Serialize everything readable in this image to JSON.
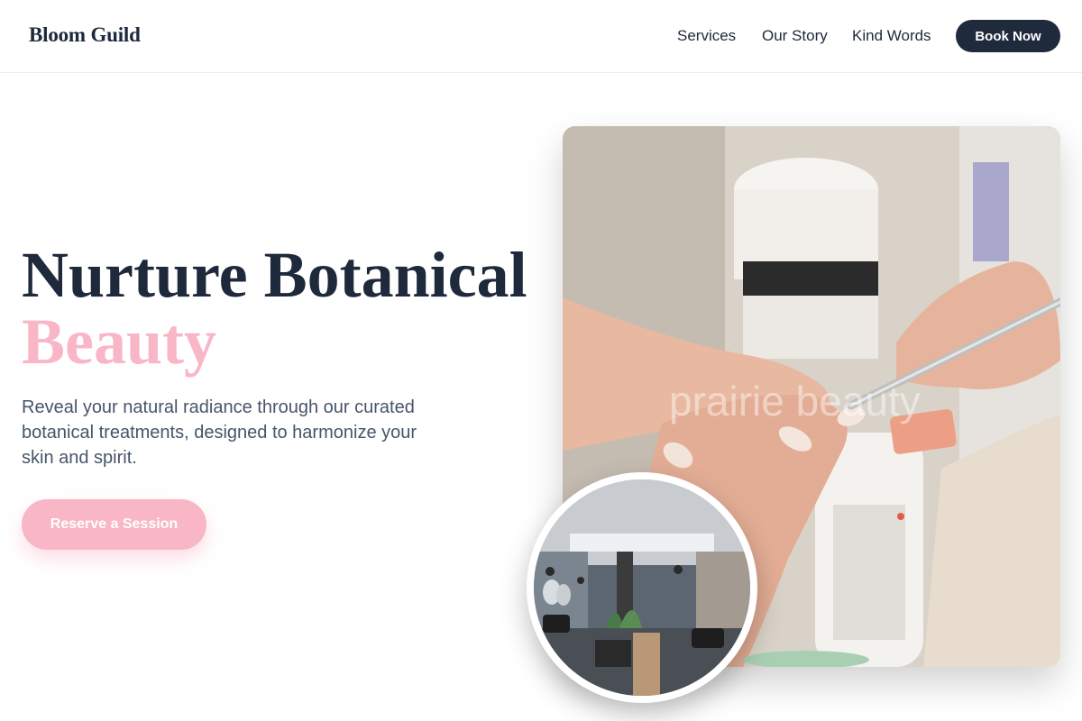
{
  "header": {
    "brand": "Bloom Guild",
    "nav": [
      "Services",
      "Our Story",
      "Kind Words"
    ],
    "cta": "Book Now"
  },
  "hero": {
    "title_line1": "Nurture Botanical",
    "title_line2": "Beauty",
    "description": "Reveal your natural radiance through our curated botanical treatments, designed to harmonize your skin and spirit.",
    "cta": "Reserve a Session"
  },
  "images": {
    "main_watermark": "prairie beauty",
    "main_subject": "manicure",
    "circle_subject": "salon-interior"
  },
  "colors": {
    "navy": "#1f2a3c",
    "pink": "#f9b6c6",
    "text_muted": "#475569"
  }
}
